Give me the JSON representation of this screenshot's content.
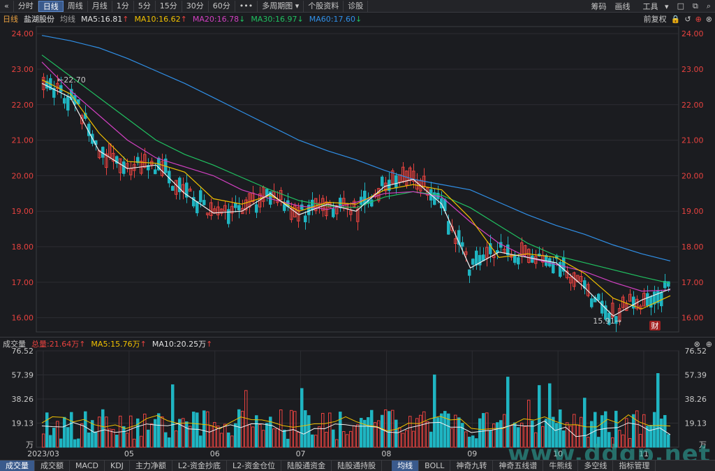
{
  "toolbar": {
    "back_icon": "double-left-chevron-icon",
    "buttons": [
      "分时",
      "日线",
      "周线",
      "月线",
      "1分",
      "5分",
      "15分",
      "30分",
      "60分",
      "•••",
      "多周期图",
      "个股资料",
      "诊股"
    ],
    "active": "日线",
    "right_buttons": [
      "筹码",
      "画线",
      "工具"
    ],
    "right_icons": [
      "square-icon",
      "multi-window-icon",
      "search-icon"
    ]
  },
  "ma_header": {
    "period": "日线",
    "stock_name": "盐湖股份",
    "ma_label": "均线",
    "ma5": "MA5:16.81",
    "ma10": "MA10:16.62",
    "ma20": "MA20:16.78",
    "ma30": "MA30:16.97",
    "ma60": "MA60:17.60",
    "adjust": "前复权",
    "icons": [
      "lock-icon",
      "undo-icon",
      "plus-circle-icon",
      "close-circle-icon"
    ]
  },
  "volume_header": {
    "title": "成交量",
    "total": "总量:21.64万",
    "ma5": "MA5:15.76万",
    "ma10": "MA10:20.25万",
    "icons": [
      "close-circle-icon",
      "plus-circle-icon"
    ]
  },
  "colors": {
    "up": "#e8423f",
    "down": "#1fb5c2",
    "ma5": "#f0f0f0",
    "ma10": "#f0c000",
    "ma20": "#d040c0",
    "ma30": "#20c060",
    "ma60": "#3090e8"
  },
  "chart_data": {
    "type": "candlestick",
    "y_ticks": [
      "24.00",
      "23.00",
      "22.00",
      "21.00",
      "20.00",
      "19.00",
      "18.00",
      "17.00",
      "16.00"
    ],
    "ylim": [
      15.6,
      24.2
    ],
    "x_ticks": [
      "2023/03",
      "05",
      "06",
      "07",
      "08",
      "09",
      "10",
      "11"
    ],
    "annotations": {
      "high": "22.70",
      "low": "15.91"
    },
    "badge": "财",
    "volume_ticks": [
      "76.52",
      "57.39",
      "38.26",
      "19.13",
      "万"
    ],
    "volume_ylim": [
      0,
      76.52
    ],
    "ma60_points": [
      23.95,
      23.8,
      23.6,
      23.3,
      22.95,
      22.6,
      22.2,
      21.8,
      21.4,
      21.0,
      20.7,
      20.45,
      20.15,
      19.9,
      19.75,
      19.6,
      19.25,
      18.9,
      18.6,
      18.35,
      18.05,
      17.8,
      17.6
    ],
    "ma30_points": [
      23.4,
      22.8,
      22.2,
      21.6,
      21.0,
      20.6,
      20.3,
      19.95,
      19.6,
      19.3,
      19.15,
      19.1,
      19.4,
      19.55,
      19.45,
      19.1,
      18.6,
      18.1,
      17.75,
      17.55,
      17.35,
      17.15,
      16.97
    ],
    "ma20_points": [
      23.2,
      22.4,
      21.7,
      21.0,
      20.5,
      20.25,
      20.0,
      19.6,
      19.35,
      19.15,
      19.05,
      19.25,
      19.5,
      19.55,
      19.4,
      18.7,
      18.1,
      17.7,
      17.5,
      17.3,
      17.0,
      16.75,
      16.78
    ],
    "ma10_points": [
      22.7,
      22.3,
      21.2,
      20.4,
      20.35,
      20.1,
      19.35,
      19.2,
      19.45,
      19.0,
      19.25,
      19.2,
      19.6,
      19.75,
      19.6,
      18.8,
      17.7,
      17.8,
      17.7,
      17.25,
      16.55,
      16.25,
      16.62
    ],
    "ma5_points": [
      22.6,
      22.2,
      20.7,
      20.2,
      20.3,
      19.5,
      18.95,
      19.0,
      19.5,
      18.9,
      19.2,
      19.0,
      19.7,
      19.9,
      19.2,
      17.4,
      17.85,
      17.7,
      17.55,
      16.85,
      16.05,
      16.5,
      16.81
    ]
  },
  "bottom_tabs": {
    "left": [
      "成交量",
      "成交额",
      "MACD",
      "KDJ",
      "主力净额",
      "L2-资金抄底",
      "L2-资金仓位",
      "陆股通资金",
      "陆股通持股"
    ],
    "right": [
      "均线",
      "BOLL",
      "神奇九转",
      "神奇五线谱",
      "牛熊线",
      "多空线"
    ],
    "end": "指标管理",
    "active_left": "成交量",
    "active_right": "均线"
  },
  "watermark": "www.ddgp.net"
}
